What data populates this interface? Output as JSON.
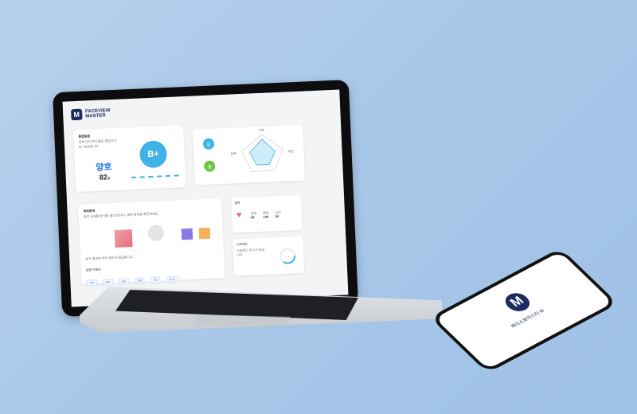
{
  "app": {
    "logo_letter": "M",
    "logo_line1": "FACEVIEW",
    "logo_line2": "MASTER"
  },
  "summary_card": {
    "heading": "종합등급",
    "desc_line1": "피부 컨디션이 좋은 편입니다",
    "desc_line2": "B+ 등급입니다",
    "status": "양호",
    "score": "82",
    "score_unit": "점",
    "grade": "B+"
  },
  "radar_card": {
    "tag1": "상",
    "tag2": "중",
    "label_top": "수분",
    "label_left": "탄력",
    "label_right": "유분"
  },
  "detail_card": {
    "heading": "피부분석",
    "intro": "피부 상태를 분석한 결과 입니다. 세부 항목을 확인하세요",
    "note": "분석 결과에 따라 관리가 필요합니다",
    "chips_title": "관련 키워드",
    "chips": [
      "수분",
      "탄력",
      "모공",
      "주름",
      "색소",
      "민감도"
    ]
  },
  "heart_card": {
    "heading": "심박",
    "metrics": [
      {
        "label": "심박",
        "value": "89"
      },
      {
        "label": "혈압",
        "value": "109"
      },
      {
        "label": "산소",
        "value": "80"
      }
    ]
  },
  "stress_card": {
    "heading": "스트레스",
    "desc": "스트레스 지수가 낮습니다"
  },
  "phone": {
    "logo_letter": "M",
    "app_name": "페이스뷰마스터 M"
  },
  "colors": {
    "brand": "#1e2b5e",
    "accent": "#1a73e8",
    "grade": "#3fb2e8",
    "background": "#a9c8e9"
  }
}
